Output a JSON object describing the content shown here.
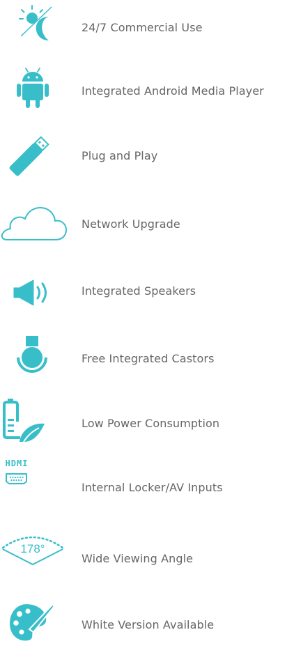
{
  "brand": {
    "accent_color": "#38bec9",
    "text_color": "#666666"
  },
  "features": [
    {
      "icon": "sun-moon-icon",
      "label": "24/7 Commercial Use"
    },
    {
      "icon": "android-icon",
      "label": "Integrated Android Media Player"
    },
    {
      "icon": "usb-stick-icon",
      "label": "Plug and Play"
    },
    {
      "icon": "cloud-icon",
      "label": "Network Upgrade"
    },
    {
      "icon": "speaker-icon",
      "label": "Integrated Speakers"
    },
    {
      "icon": "castor-icon",
      "label": "Free Integrated Castors"
    },
    {
      "icon": "battery-leaf-icon",
      "label": "Low Power Consumption"
    },
    {
      "icon": "hdmi-vga-icon",
      "label": "Internal Locker/AV Inputs",
      "icon_text": "HDMI"
    },
    {
      "icon": "viewing-angle-icon",
      "label": "Wide Viewing Angle",
      "icon_text": "178°"
    },
    {
      "icon": "paint-palette-icon",
      "label": "White Version Available"
    }
  ]
}
